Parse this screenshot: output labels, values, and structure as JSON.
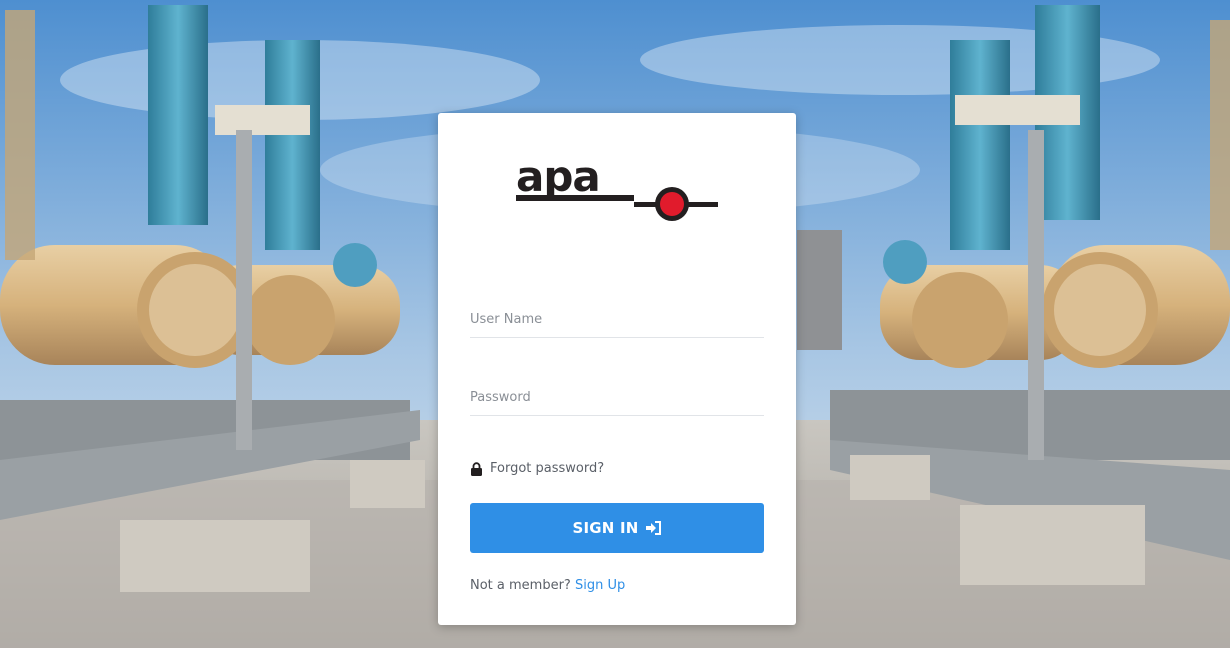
{
  "colors": {
    "accent": "#2f8fe6",
    "logo_red": "#e11b2c",
    "logo_black": "#231f20"
  },
  "brand": {
    "logo_text": "apa"
  },
  "form": {
    "username": {
      "placeholder": "User Name",
      "value": ""
    },
    "password": {
      "placeholder": "Password",
      "value": ""
    },
    "forgot_label": "Forgot password?",
    "forgot_icon": "lock-icon",
    "signin_label": "SIGN IN",
    "signin_icon": "sign-in-icon",
    "member_prompt": "Not a member?",
    "signup_label": "Sign Up"
  }
}
